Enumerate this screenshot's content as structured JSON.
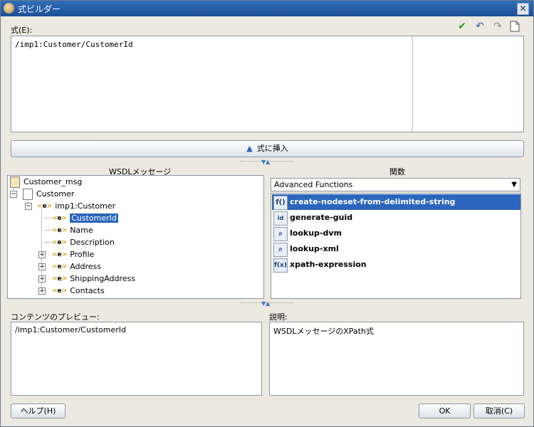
{
  "window": {
    "title": "式ビルダー",
    "close_glyph": "✕"
  },
  "expression": {
    "label": "式(E):",
    "text": "/imp1:Customer/CustomerId"
  },
  "toolbar": {
    "icons": [
      "check-icon",
      "undo-icon",
      "redo-icon",
      "new-document-icon"
    ]
  },
  "insert_button": {
    "label": "式に挿入"
  },
  "wsdl_panel": {
    "header": "WSDLメッセージ",
    "tree": {
      "root": "Customer_msg",
      "customer": "Customer",
      "imp1": "imp1:Customer",
      "leaves": [
        "CustomerId",
        "Name",
        "Description"
      ],
      "collapsed": [
        "Profile",
        "Address",
        "ShippingAddress",
        "Contacts"
      ]
    }
  },
  "functions_panel": {
    "header": "関数",
    "category": "Advanced Functions",
    "items": [
      {
        "label": "create-nodeset-from-delimited-string",
        "icon": "f()"
      },
      {
        "label": "generate-guid",
        "icon": "id"
      },
      {
        "label": "lookup-dvm",
        "icon": "magnifier"
      },
      {
        "label": "lookup-xml",
        "icon": "magnifier"
      },
      {
        "label": "xpath-expression",
        "icon": "f(x)"
      }
    ]
  },
  "preview": {
    "label": "コンテンツのプレビュー:",
    "text": "/imp1:Customer/CustomerId"
  },
  "description": {
    "label": "説明:",
    "text": "WSDLメッセージのXPath式"
  },
  "buttons": {
    "help": "ヘルプ(H)",
    "ok": "OK",
    "cancel": "取消(C)"
  },
  "colors": {
    "selection": "#2b65bd",
    "titlebar": "#1c4f96"
  }
}
